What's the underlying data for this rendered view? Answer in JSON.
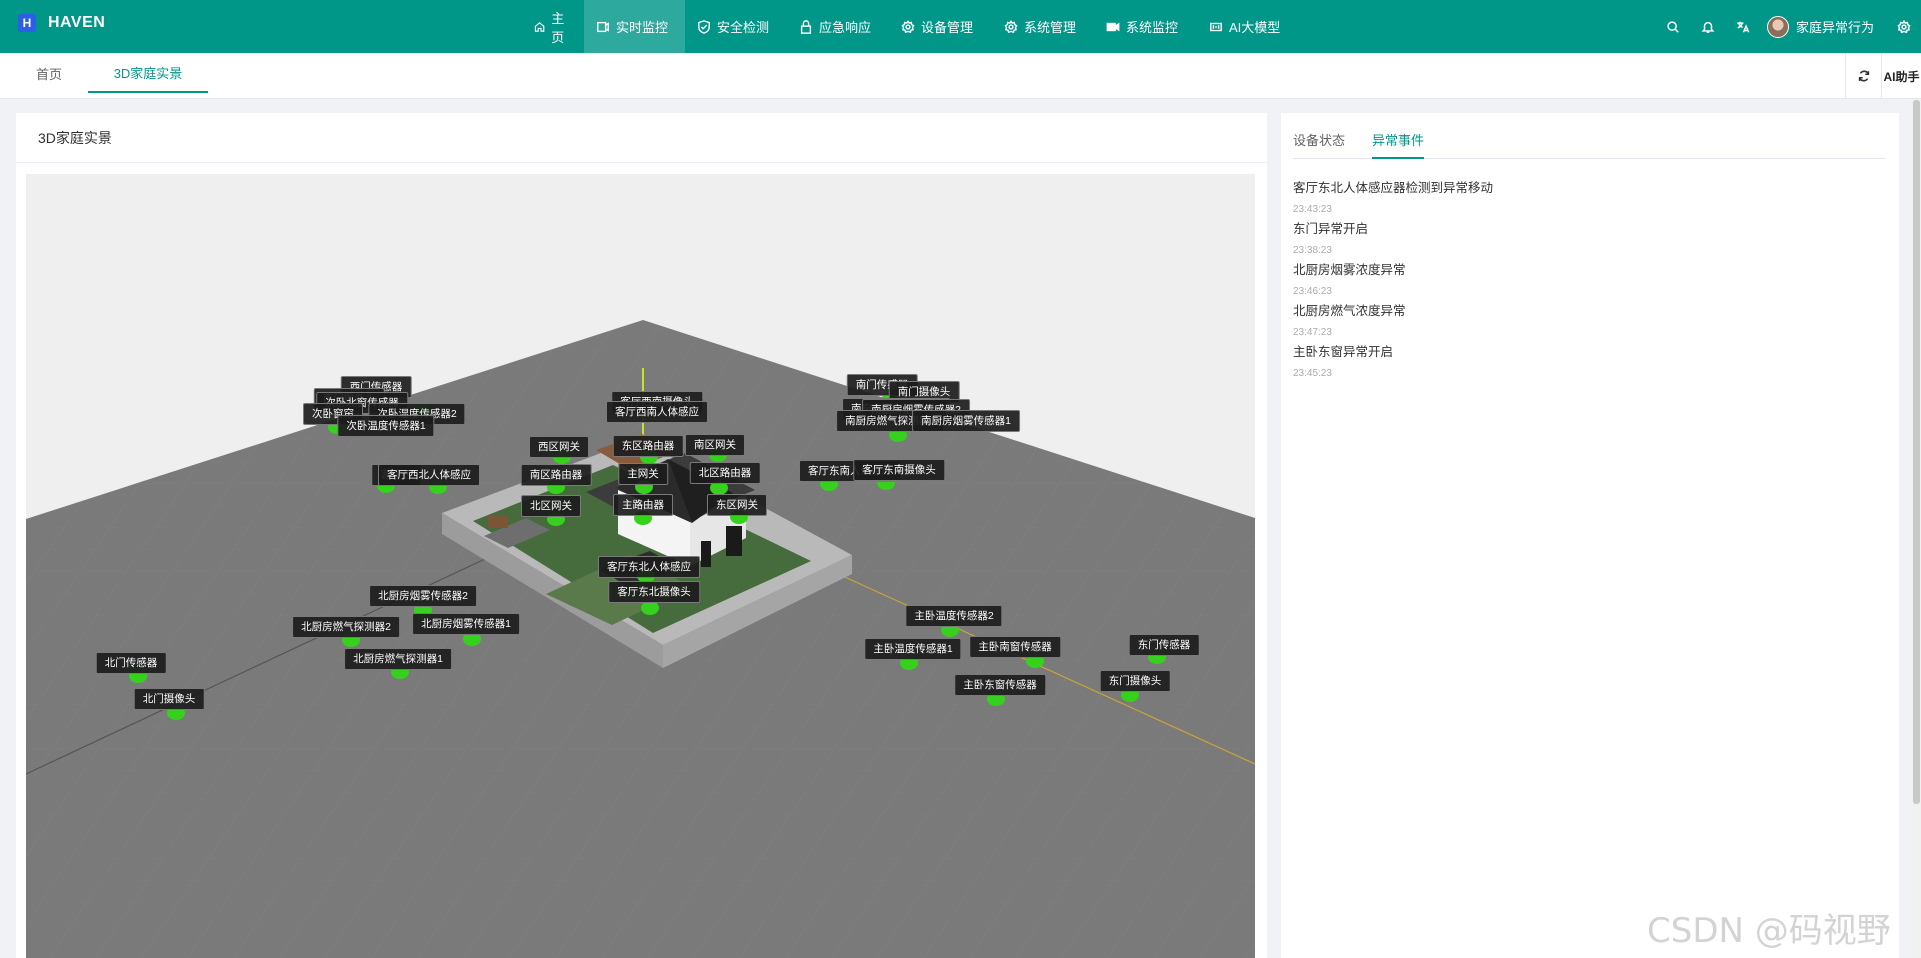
{
  "app": {
    "logo_letter": "H",
    "name": "HAVEN"
  },
  "nav": [
    {
      "label": "主页",
      "icon": "home-icon"
    },
    {
      "label": "实时监控",
      "icon": "monitor-icon",
      "active": true
    },
    {
      "label": "安全检测",
      "icon": "shield-icon"
    },
    {
      "label": "应急响应",
      "icon": "lock-icon"
    },
    {
      "label": "设备管理",
      "icon": "gear-icon"
    },
    {
      "label": "系统管理",
      "icon": "gear-icon"
    },
    {
      "label": "系统监控",
      "icon": "video-camera-icon"
    },
    {
      "label": "AI大模型",
      "icon": "ai-icon"
    }
  ],
  "tools": [
    "search-icon",
    "bell-icon",
    "translate-icon"
  ],
  "user": {
    "name": "家庭异常行为"
  },
  "tabs": [
    {
      "label": "首页"
    },
    {
      "label": "3D家庭实景",
      "active": true
    }
  ],
  "ai_helper": "AI助手",
  "main": {
    "title": "3D家庭实景"
  },
  "scene": {
    "labels": [
      "西门传感器",
      "西门摄像头",
      "次卧北窗传感器",
      "次卧窗帘",
      "次卧湿度传感器2",
      "次卧温度传感器1",
      "客厅西南摄像头",
      "客厅西南人体感应",
      "南门传感器",
      "南门摄像头",
      "南厨房燃气探测器2",
      "南厨房烟雾传感器2",
      "南厨房燃气探测器1",
      "南厨房烟雾传感器1",
      "西区网关",
      "东区路由器",
      "南区网关",
      "客厅西",
      "客厅西北人体感应",
      "南区路由器",
      "主网关",
      "北区路由器",
      "客厅东南人体感应",
      "客厅东南摄像头",
      "北区网关",
      "主路由器",
      "东区网关",
      "客厅东北人体感应",
      "客厅东北摄像头",
      "北厨房烟雾传感器2",
      "北厨房燃气探测器2",
      "北厨房烟雾传感器1",
      "北厨房燃气探测器1",
      "北门传感器",
      "北门摄像头",
      "主卧温度传感器2",
      "主卧温度传感器1",
      "主卧南窗传感器",
      "东门传感器",
      "主卧东窗传感器",
      "东门摄像头"
    ]
  },
  "side": {
    "tabs": [
      {
        "label": "设备状态"
      },
      {
        "label": "异常事件",
        "active": true
      }
    ],
    "events": [
      {
        "title": "客厅东北人体感应器检测到异常移动",
        "time": "23:43:23"
      },
      {
        "title": "东门异常开启",
        "time": "23:38:23"
      },
      {
        "title": "北厨房烟雾浓度异常",
        "time": "23:46:23"
      },
      {
        "title": "北厨房燃气浓度异常",
        "time": "23:47:23"
      },
      {
        "title": "主卧东窗异常开启",
        "time": "23:45:23"
      }
    ]
  },
  "watermark": "CSDN @码视野",
  "colors": {
    "primary": "#009688",
    "marker": "#35d11c"
  }
}
